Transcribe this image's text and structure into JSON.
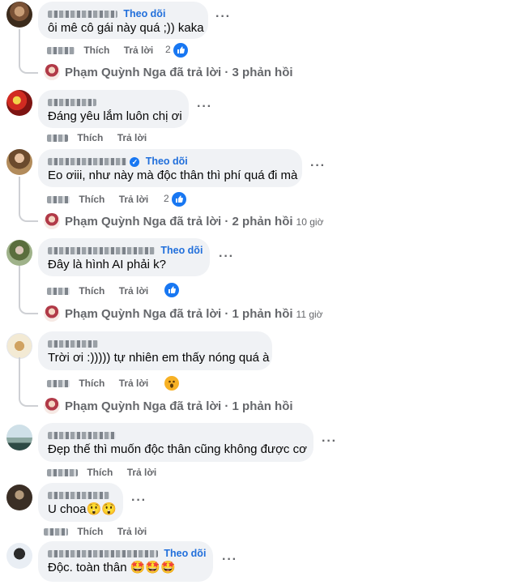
{
  "labels": {
    "like": "Thích",
    "reply": "Trả lời",
    "follow": "Theo dõi"
  },
  "comments": [
    {
      "text": "ôi mê cô gái này quá ;)) kaka",
      "reaction_count": "2",
      "reaction": "like",
      "reply_summary": {
        "author": "Phạm Quỳnh Nga",
        "text": "đã trả lời · 3 phản hồi",
        "time": ""
      }
    },
    {
      "text": "Đáng yêu lắm luôn chị ơi",
      "reaction_count": "",
      "reaction": ""
    },
    {
      "text": "Eo ơiii, như này mà độc thân thì phí quá đi mà",
      "reaction_count": "2",
      "reaction": "like",
      "reply_summary": {
        "author": "Phạm Quỳnh Nga",
        "text": "đã trả lời · 2 phản hồi",
        "time": "10 giờ"
      }
    },
    {
      "text": "Đây là hình AI phải k?",
      "reaction_count": "",
      "reaction": "like",
      "reply_summary": {
        "author": "Phạm Quỳnh Nga",
        "text": "đã trả lời · 1 phản hồi",
        "time": "11 giờ"
      }
    },
    {
      "text": "Trời ơi :))))) tự nhiên em thấy nóng quá à",
      "reaction_count": "",
      "reaction": "wow",
      "reply_summary": {
        "author": "Phạm Quỳnh Nga",
        "text": "đã trả lời · 1 phản hồi",
        "time": ""
      }
    },
    {
      "text": "Đẹp thế thì muốn độc thân cũng không được cơ",
      "reaction_count": "",
      "reaction": ""
    },
    {
      "text": "U choa😲😲",
      "reaction_count": "",
      "reaction": ""
    },
    {
      "text": "Độc. toàn thân 🤩🤩🤩",
      "reaction_count": "",
      "reaction": ""
    }
  ],
  "icons": {
    "more": "more-options-icon",
    "like": "like-icon",
    "wow": "wow-icon",
    "verified": "verified-badge-icon"
  }
}
